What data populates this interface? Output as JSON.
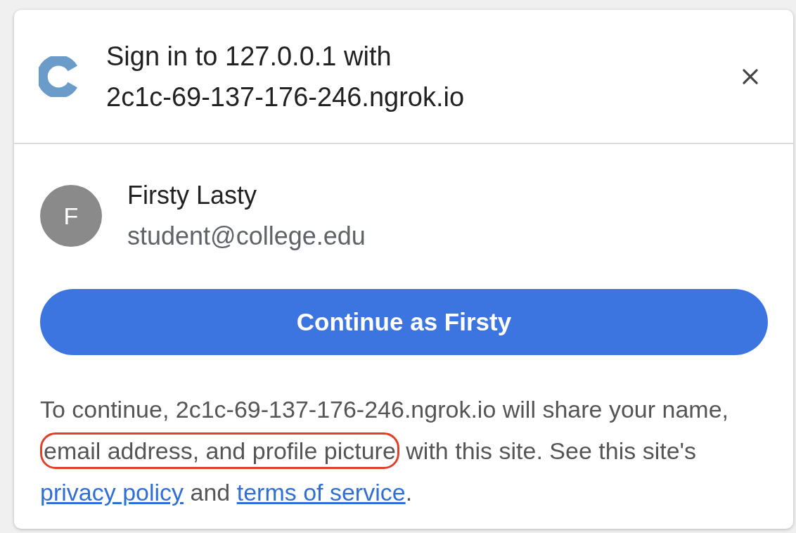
{
  "dialog": {
    "title_lines": [
      "Sign in to 127.0.0.1 with",
      "2c1c-69-137-176-246.ngrok.io"
    ]
  },
  "account": {
    "avatar_letter": "F",
    "name": "Firsty Lasty",
    "email": "student@college.edu"
  },
  "continue_button": "Continue as Firsty",
  "disclosure": [
    {
      "kind": "text",
      "text": "To continue, 2c1c-69-137-176-246.ngrok.io will share your name, "
    },
    {
      "kind": "highlight",
      "text": "email address, and profile picture"
    },
    {
      "kind": "text",
      "text": " with this site. See this site's "
    },
    {
      "kind": "link",
      "text": "privacy policy"
    },
    {
      "kind": "text",
      "text": " and "
    },
    {
      "kind": "link",
      "text": "terms of service"
    },
    {
      "kind": "text",
      "text": "."
    }
  ]
}
